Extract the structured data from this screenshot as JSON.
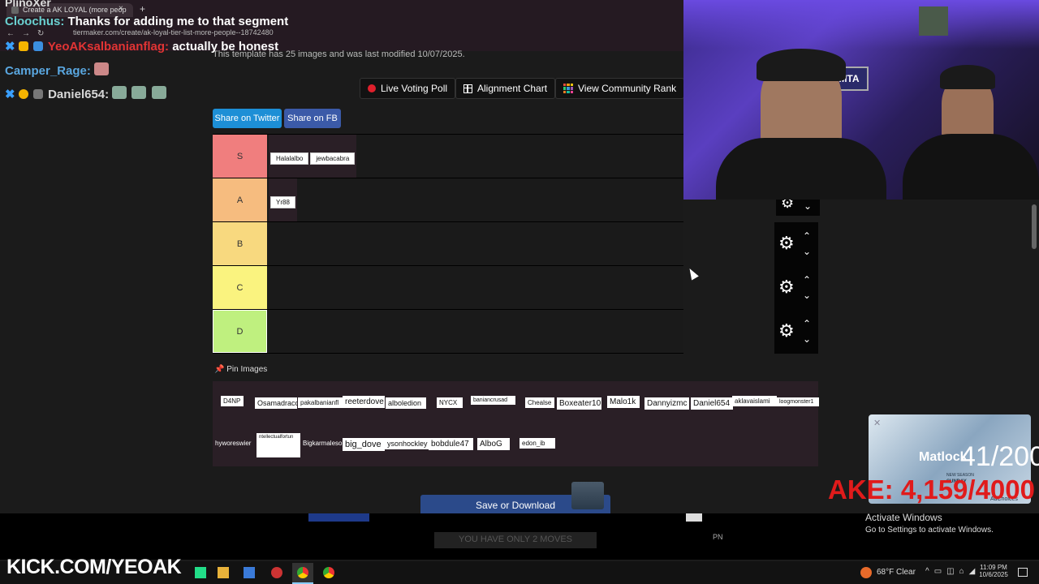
{
  "browser": {
    "tab_title": "Create a AK LOYAL (more peop",
    "tab_close": "×",
    "new_tab": "+",
    "url": "tiermaker.com/create/ak-loyal-tier-list-more-people--18742480",
    "nav_icons": [
      "back-icon",
      "forward-icon",
      "reload-icon"
    ]
  },
  "page": {
    "modified_text": "This template has 25 images and was last modified 10/07/2025.",
    "buttons": {
      "live_voting": "Live Voting Poll",
      "alignment": "Alignment Chart",
      "community_rank": "View Community Rank"
    },
    "share": {
      "twitter": "Share on Twitter",
      "fb": "Share on FB",
      "twitter_color": "#1d8fd6",
      "fb_color": "#3b5aa8"
    },
    "tiers": [
      {
        "label": "S",
        "color": "#f07e7e",
        "items": [
          "Halalalbo",
          "jewbacabra"
        ]
      },
      {
        "label": "A",
        "color": "#f6bc7f",
        "items": [
          "Yr88"
        ]
      },
      {
        "label": "B",
        "color": "#f8d97f",
        "items": []
      },
      {
        "label": "C",
        "color": "#faf37f",
        "items": []
      },
      {
        "label": "D",
        "color": "#bff07f",
        "items": []
      }
    ],
    "pin_label": "Pin Images",
    "pool_row1": [
      "D4NP",
      "Osamadraco",
      "pakalbanianfl",
      "reeterdove",
      "alboledion",
      "NYCX",
      "baniancrusad",
      "Chealse",
      "Boxeater10",
      "Malo1k",
      "Dannyizmc",
      "Daniel654",
      "aklavaislami",
      "loogmonster1"
    ],
    "pool_row2": [
      "hyworeswier",
      "ntellectualfortun",
      "Bigkarmaleso",
      "big_dove",
      "ysonhockley",
      "bobdule47",
      "AlboG",
      "edon_ib"
    ],
    "save_button": "Save or Download"
  },
  "chat": [
    {
      "user": "Cloochus:",
      "message": "Thanks for adding me to that segment",
      "user_color": "#6ad0d0"
    },
    {
      "user": "YeoAKsalbanianflag:",
      "message": "actually be honest",
      "user_color": "#e23434"
    },
    {
      "user": "Camper_Rage:",
      "message": "",
      "user_color": "#5aa7e0"
    },
    {
      "user": "Daniel654:",
      "message": "",
      "user_color": "#d8d8d8"
    }
  ],
  "overlay": {
    "counter_follows": "41/200",
    "counter_subs": "AKE: 4,159/4000",
    "matlock_title": "Matlock",
    "matlock_sub": "NEW SEASON",
    "matlock_day": "SUNDAY",
    "adchoices": "AdChoices",
    "banner_text": "YOU HAVE ONLY 2 MOVES",
    "kick": "KICK.COM/YEOAK",
    "pn": "PN"
  },
  "windows": {
    "activate_title": "Activate Windows",
    "activate_sub": "Go to Settings to activate Windows.",
    "weather": "68°F  Clear",
    "time": "11:09 PM",
    "date": "10/6/2025"
  }
}
